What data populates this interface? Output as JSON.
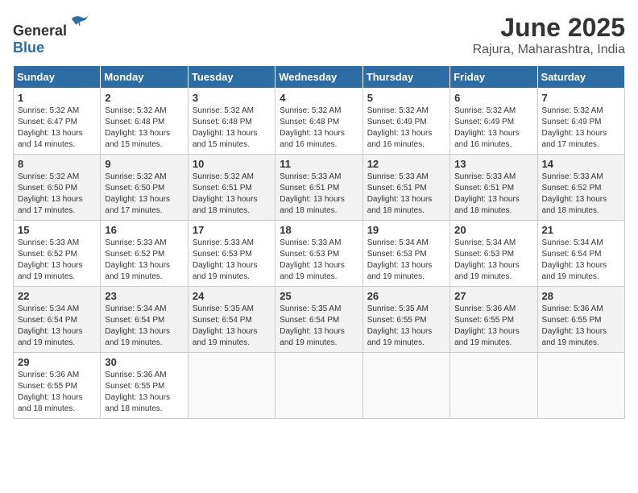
{
  "logo": {
    "text_general": "General",
    "text_blue": "Blue"
  },
  "title": {
    "month_year": "June 2025",
    "location": "Rajura, Maharashtra, India"
  },
  "days_of_week": [
    "Sunday",
    "Monday",
    "Tuesday",
    "Wednesday",
    "Thursday",
    "Friday",
    "Saturday"
  ],
  "weeks": [
    [
      {
        "day": "1",
        "sunrise": "5:32 AM",
        "sunset": "6:47 PM",
        "daylight": "13 hours and 14 minutes."
      },
      {
        "day": "2",
        "sunrise": "5:32 AM",
        "sunset": "6:48 PM",
        "daylight": "13 hours and 15 minutes."
      },
      {
        "day": "3",
        "sunrise": "5:32 AM",
        "sunset": "6:48 PM",
        "daylight": "13 hours and 15 minutes."
      },
      {
        "day": "4",
        "sunrise": "5:32 AM",
        "sunset": "6:48 PM",
        "daylight": "13 hours and 16 minutes."
      },
      {
        "day": "5",
        "sunrise": "5:32 AM",
        "sunset": "6:49 PM",
        "daylight": "13 hours and 16 minutes."
      },
      {
        "day": "6",
        "sunrise": "5:32 AM",
        "sunset": "6:49 PM",
        "daylight": "13 hours and 16 minutes."
      },
      {
        "day": "7",
        "sunrise": "5:32 AM",
        "sunset": "6:49 PM",
        "daylight": "13 hours and 17 minutes."
      }
    ],
    [
      {
        "day": "8",
        "sunrise": "5:32 AM",
        "sunset": "6:50 PM",
        "daylight": "13 hours and 17 minutes."
      },
      {
        "day": "9",
        "sunrise": "5:32 AM",
        "sunset": "6:50 PM",
        "daylight": "13 hours and 17 minutes."
      },
      {
        "day": "10",
        "sunrise": "5:32 AM",
        "sunset": "6:51 PM",
        "daylight": "13 hours and 18 minutes."
      },
      {
        "day": "11",
        "sunrise": "5:33 AM",
        "sunset": "6:51 PM",
        "daylight": "13 hours and 18 minutes."
      },
      {
        "day": "12",
        "sunrise": "5:33 AM",
        "sunset": "6:51 PM",
        "daylight": "13 hours and 18 minutes."
      },
      {
        "day": "13",
        "sunrise": "5:33 AM",
        "sunset": "6:51 PM",
        "daylight": "13 hours and 18 minutes."
      },
      {
        "day": "14",
        "sunrise": "5:33 AM",
        "sunset": "6:52 PM",
        "daylight": "13 hours and 18 minutes."
      }
    ],
    [
      {
        "day": "15",
        "sunrise": "5:33 AM",
        "sunset": "6:52 PM",
        "daylight": "13 hours and 19 minutes."
      },
      {
        "day": "16",
        "sunrise": "5:33 AM",
        "sunset": "6:52 PM",
        "daylight": "13 hours and 19 minutes."
      },
      {
        "day": "17",
        "sunrise": "5:33 AM",
        "sunset": "6:53 PM",
        "daylight": "13 hours and 19 minutes."
      },
      {
        "day": "18",
        "sunrise": "5:33 AM",
        "sunset": "6:53 PM",
        "daylight": "13 hours and 19 minutes."
      },
      {
        "day": "19",
        "sunrise": "5:34 AM",
        "sunset": "6:53 PM",
        "daylight": "13 hours and 19 minutes."
      },
      {
        "day": "20",
        "sunrise": "5:34 AM",
        "sunset": "6:53 PM",
        "daylight": "13 hours and 19 minutes."
      },
      {
        "day": "21",
        "sunrise": "5:34 AM",
        "sunset": "6:54 PM",
        "daylight": "13 hours and 19 minutes."
      }
    ],
    [
      {
        "day": "22",
        "sunrise": "5:34 AM",
        "sunset": "6:54 PM",
        "daylight": "13 hours and 19 minutes."
      },
      {
        "day": "23",
        "sunrise": "5:34 AM",
        "sunset": "6:54 PM",
        "daylight": "13 hours and 19 minutes."
      },
      {
        "day": "24",
        "sunrise": "5:35 AM",
        "sunset": "6:54 PM",
        "daylight": "13 hours and 19 minutes."
      },
      {
        "day": "25",
        "sunrise": "5:35 AM",
        "sunset": "6:54 PM",
        "daylight": "13 hours and 19 minutes."
      },
      {
        "day": "26",
        "sunrise": "5:35 AM",
        "sunset": "6:55 PM",
        "daylight": "13 hours and 19 minutes."
      },
      {
        "day": "27",
        "sunrise": "5:36 AM",
        "sunset": "6:55 PM",
        "daylight": "13 hours and 19 minutes."
      },
      {
        "day": "28",
        "sunrise": "5:36 AM",
        "sunset": "6:55 PM",
        "daylight": "13 hours and 19 minutes."
      }
    ],
    [
      {
        "day": "29",
        "sunrise": "5:36 AM",
        "sunset": "6:55 PM",
        "daylight": "13 hours and 18 minutes."
      },
      {
        "day": "30",
        "sunrise": "5:36 AM",
        "sunset": "6:55 PM",
        "daylight": "13 hours and 18 minutes."
      },
      null,
      null,
      null,
      null,
      null
    ]
  ],
  "labels": {
    "sunrise": "Sunrise:",
    "sunset": "Sunset:",
    "daylight": "Daylight:"
  }
}
